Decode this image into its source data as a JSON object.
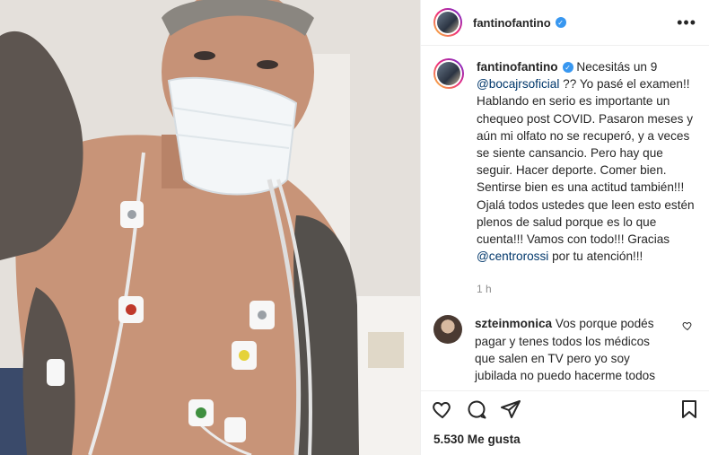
{
  "post": {
    "username": "fantinofantino",
    "more_icon": "more-horizontal-icon",
    "caption": {
      "username": "fantinofantino",
      "part1": " Necesitás un 9 ",
      "mention1": "@bocajrsoficial",
      "part2": " ?? Yo pasé el examen!! Hablando en serio es importante un chequeo post COVID. Pasaron meses y aún mi olfato no se recuperó, y a veces se siente cansancio. Pero hay que seguir. Hacer deporte. Comer bien. Sentirse bien es una actitud también!!! Ojalá todos ustedes que leen esto estén plenos de salud porque es lo que cuenta!!! Vamos con todo!!! Gracias ",
      "mention2": "@centrorossi",
      "part3": " por tu atención!!!"
    },
    "time": "1 h",
    "comments": [
      {
        "username": "szteinmonica",
        "text": " Vos porque podés pagar y tenes todos los médicos que salen en TV pero yo soy jubilada no puedo hacerme todos"
      }
    ],
    "likes": "5.530 Me gusta",
    "actions": [
      "heart-icon",
      "comment-icon",
      "share-icon",
      "bookmark-icon"
    ]
  },
  "colors": {
    "verified": "#3897f0",
    "mention": "#00376b",
    "muted": "#8e8e8e"
  }
}
